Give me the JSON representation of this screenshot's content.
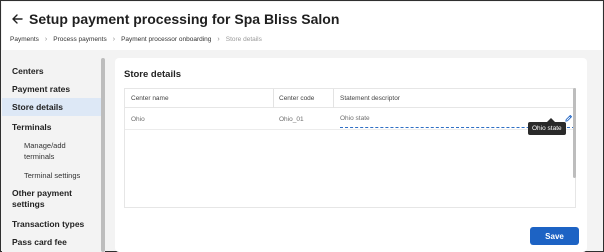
{
  "header": {
    "title": "Setup payment processing for Spa Bliss Salon",
    "breadcrumbs": [
      "Payments",
      "Process payments",
      "Payment processor onboarding",
      "Store details"
    ]
  },
  "sidebar": {
    "items": [
      {
        "label": "Centers"
      },
      {
        "label": "Payment rates"
      },
      {
        "label": "Store details",
        "active": true
      },
      {
        "label": "Terminals"
      },
      {
        "label": "Manage/add terminals",
        "sub": true
      },
      {
        "label": "Terminal settings",
        "sub": true
      },
      {
        "label": "Other payment settings"
      },
      {
        "label": "Transaction types"
      },
      {
        "label": "Pass card fee"
      }
    ]
  },
  "main": {
    "section_title": "Store details",
    "table": {
      "columns": [
        "Center name",
        "Center code",
        "Statement descriptor"
      ],
      "rows": [
        {
          "center_name": "Ohio",
          "center_code": "Ohio_01",
          "statement_descriptor": "Ohio state"
        }
      ]
    },
    "tooltip": "Ohio state",
    "save_label": "Save"
  },
  "colors": {
    "accent": "#1d63c4",
    "active_nav_bg": "#dde8f6",
    "tooltip_bg": "#2a2a2a"
  },
  "icons": [
    "back-arrow-icon",
    "chevron-right-icon",
    "pencil-icon"
  ]
}
